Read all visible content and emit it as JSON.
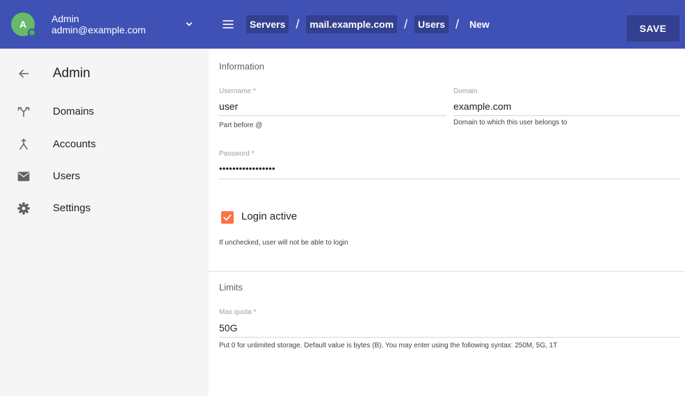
{
  "account": {
    "avatar_letter": "A",
    "name": "Admin",
    "email": "admin@example.com"
  },
  "breadcrumbs": [
    "Servers",
    "mail.example.com",
    "Users",
    "New"
  ],
  "toolbar": {
    "save_label": "SAVE"
  },
  "sidebar": {
    "title": "Admin",
    "items": [
      {
        "label": "Domains",
        "icon": "domains-fork-icon"
      },
      {
        "label": "Accounts",
        "icon": "accounts-merge-icon"
      },
      {
        "label": "Users",
        "icon": "envelope-icon"
      },
      {
        "label": "Settings",
        "icon": "gear-icon"
      }
    ]
  },
  "form": {
    "information_title": "Information",
    "username": {
      "label": "Username *",
      "value": "user",
      "hint": "Part before @"
    },
    "domain": {
      "label": "Domain",
      "value": "example.com",
      "hint": "Domain to which this user belongs to"
    },
    "password": {
      "label": "Password *",
      "value": "•••••••••••••••••"
    },
    "login_active": {
      "label": "Login active",
      "checked": true,
      "hint": "If unchecked, user will not be able to login"
    },
    "limits_title": "Limits",
    "max_quota": {
      "label": "Max quota *",
      "value": "50G",
      "hint": "Put 0 for unlimited storage. Default value is bytes (B). You may enter using the following syntax: 250M, 5G, 1T"
    }
  },
  "colors": {
    "primary": "#3f51b5",
    "primary_dark": "#32408f",
    "accent": "#ff7043",
    "status_online": "#4caf50"
  }
}
